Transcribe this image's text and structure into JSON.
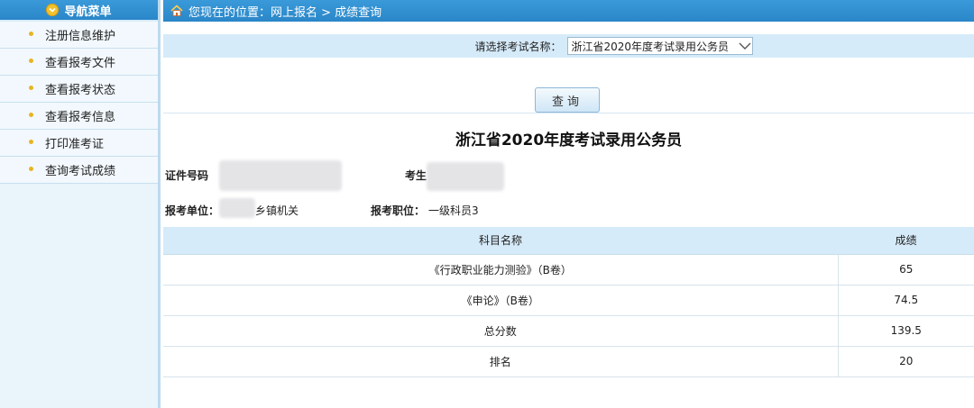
{
  "sidebar": {
    "title": "导航菜单",
    "items": [
      {
        "label": "注册信息维护"
      },
      {
        "label": "查看报考文件"
      },
      {
        "label": "查看报考状态"
      },
      {
        "label": "查看报考信息"
      },
      {
        "label": "打印准考证"
      },
      {
        "label": "查询考试成绩"
      }
    ]
  },
  "breadcrumb": "您现在的位置：网上报名 > 成绩查询",
  "exam_select": {
    "label": "请选择考试名称：",
    "selected": "浙江省2020年度考试录用公务员"
  },
  "query_button": "查询",
  "result": {
    "title": "浙江省2020年度考试录用公务员",
    "id_label": "证件号码",
    "name_label": "考生",
    "unit_label": "报考单位：",
    "unit_value": "乡镇机关",
    "position_label": "报考职位：",
    "position_value": "一级科员3"
  },
  "table": {
    "headers": [
      "科目名称",
      "成绩"
    ],
    "rows": [
      {
        "subject": "《行政职业能力测验》（B卷）",
        "score": "65"
      },
      {
        "subject": "《申论》（B卷）",
        "score": "74.5"
      },
      {
        "subject": "总分数",
        "score": "139.5"
      },
      {
        "subject": "排名",
        "score": "20"
      }
    ]
  },
  "colors": {
    "header_blue": "#2a86c8",
    "light_blue": "#d6ebf9",
    "bullet_yellow": "#e8b422"
  }
}
